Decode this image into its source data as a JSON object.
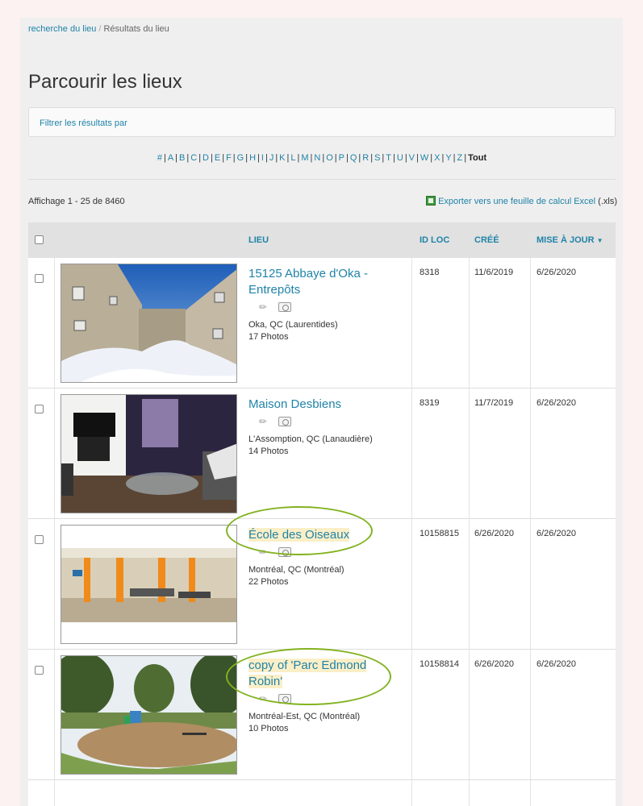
{
  "breadcrumb": {
    "link": "recherche du lieu",
    "sep": "/",
    "current": "Résultats du lieu"
  },
  "page_title": "Parcourir les lieux",
  "filter_label": "Filtrer les résultats par",
  "alphabet": [
    "#",
    "A",
    "B",
    "C",
    "D",
    "E",
    "F",
    "G",
    "H",
    "I",
    "J",
    "K",
    "L",
    "M",
    "N",
    "O",
    "P",
    "Q",
    "R",
    "S",
    "T",
    "U",
    "V",
    "W",
    "X",
    "Y",
    "Z"
  ],
  "alphabet_current": "Tout",
  "results_count": "Affichage 1 - 25 de 8460",
  "export": {
    "link": "Exporter vers une feuille de calcul Excel",
    "suffix": "(.xls)"
  },
  "columns": {
    "place": "LIEU",
    "loc_id": "ID LOC",
    "created": "CRÉÉ",
    "updated": "MISE À JOUR",
    "updated_sort_icon": "caret-down-icon"
  },
  "rows": [
    {
      "title": "15125 Abbaye d'Oka - Entrepôts",
      "location": "Oka, QC (Laurentides)",
      "photos": "17 Photos",
      "loc_id": "8318",
      "created": "11/6/2019",
      "updated": "6/26/2020"
    },
    {
      "title": "Maison Desbiens",
      "location": "L'Assomption, QC (Lanaudière)",
      "photos": "14 Photos",
      "loc_id": "8319",
      "created": "11/7/2019",
      "updated": "6/26/2020"
    },
    {
      "title": "École des Oiseaux",
      "location": "Montréal, QC (Montréal)",
      "photos": "22 Photos",
      "loc_id": "10158815",
      "created": "6/26/2020",
      "updated": "6/26/2020"
    },
    {
      "title": "copy of 'Parc Edmond Robin'",
      "location": "Montréal-Est, QC (Montréal)",
      "photos": "10 Photos",
      "loc_id": "10158814",
      "created": "6/26/2020",
      "updated": "6/26/2020"
    }
  ],
  "colors": {
    "link": "#1f83a8",
    "highlight": "#fbefc8",
    "annotation": "#82b21f",
    "header_bg": "#e1e1e1"
  }
}
